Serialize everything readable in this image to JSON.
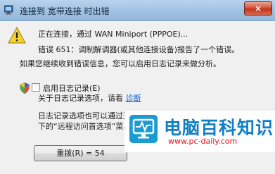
{
  "window": {
    "title": "连接到 宽带连接 时出错",
    "close_label": "×"
  },
  "message": {
    "connecting": "正在连接，通过 WAN Miniport (PPPOE)...",
    "error": "错误 651：调制解调器(或其他连接设备)报告了一个错误。",
    "hint": "如果您继续收到错误信息，您可以启用日志记录来做分析。"
  },
  "logging": {
    "checkbox_label": "启用日志记录(E)",
    "about_text": "关于日志记录选项，请看 ",
    "diagnose_link": "诊断",
    "note_line1": "日志记录选项也可以通过选择“网络连接文件夹”的“高级”菜单",
    "note_line2": "下的“远程访问首选项”菜单项来访问。"
  },
  "buttons": {
    "retry": "重拨(R) = 54"
  },
  "watermark": {
    "title": "电脑百科知识",
    "url": "www.pc-daily.com"
  },
  "colors": {
    "link": "#0b59c9",
    "watermark_title": "#127fc4",
    "watermark_url": "#d8141a"
  }
}
